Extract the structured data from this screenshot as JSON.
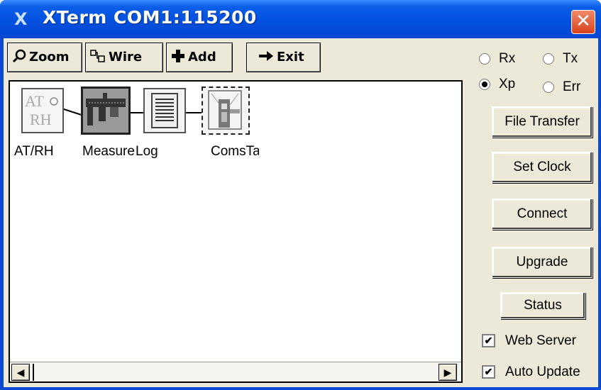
{
  "window": {
    "title": "XTerm COM1:115200",
    "app_icon": "x-logo-icon",
    "close_glyph": "✕"
  },
  "toolbar": {
    "zoom_label": "Zoom",
    "wire_label": "Wire",
    "add_label": "Add",
    "exit_label": "Exit"
  },
  "diagram": {
    "nodes": [
      {
        "label": "AT/RH",
        "icon": "at-rh-sensor-icon",
        "glyph": "AT RH"
      },
      {
        "label": "Measure",
        "icon": "caliper-icon"
      },
      {
        "label": "Log",
        "icon": "log-document-icon"
      },
      {
        "label": "ComsTag",
        "icon": "coms-tag-icon"
      }
    ]
  },
  "radios": {
    "rx": {
      "label": "Rx",
      "checked": false
    },
    "tx": {
      "label": "Tx",
      "checked": false
    },
    "xp": {
      "label": "Xp",
      "checked": true
    },
    "err": {
      "label": "Err",
      "checked": false
    }
  },
  "buttons": {
    "file_transfer": "File Transfer",
    "set_clock": "Set Clock",
    "connect": "Connect",
    "upgrade": "Upgrade",
    "status": "Status"
  },
  "checks": {
    "web_server": {
      "label": "Web Server",
      "checked": true
    },
    "auto_update": {
      "label": "Auto Update",
      "checked": true
    }
  },
  "scrollbar": {
    "left_glyph": "◀",
    "right_glyph": "▶"
  }
}
